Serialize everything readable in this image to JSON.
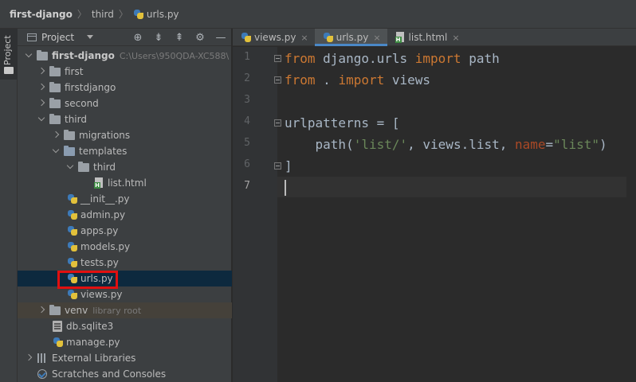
{
  "breadcrumb": {
    "project": "first-django",
    "folder": "third",
    "file": "urls.py"
  },
  "toolstrip": {
    "project_label": "Project"
  },
  "panel": {
    "title": "Project",
    "tools": [
      "⊕",
      "⇟",
      "⇞",
      "⚙",
      "—"
    ]
  },
  "tree": {
    "root": {
      "name": "first-django",
      "path": "C:\\Users\\950QDA-XC588\\"
    },
    "first": "first",
    "firstdjango": "firstdjango",
    "second": "second",
    "third": "third",
    "migrations": "migrations",
    "templates": "templates",
    "templates_third": "third",
    "list_html": "list.html",
    "init_py": "__init__.py",
    "admin_py": "admin.py",
    "apps_py": "apps.py",
    "models_py": "models.py",
    "tests_py": "tests.py",
    "urls_py": "urls.py",
    "views_py": "views.py",
    "venv": "venv",
    "venv_hint": "library root",
    "db": "db.sqlite3",
    "manage": "manage.py",
    "external": "External Libraries",
    "scratches": "Scratches and Consoles"
  },
  "tabs": [
    {
      "label": "views.py",
      "close": "×"
    },
    {
      "label": "urls.py",
      "close": "×"
    },
    {
      "label": "list.html",
      "close": "×"
    }
  ],
  "editor": {
    "line_numbers": [
      "1",
      "2",
      "3",
      "4",
      "5",
      "6",
      "7"
    ],
    "line1": {
      "kw1": "from",
      "mod": " django.urls ",
      "kw2": "import",
      "rest": " path"
    },
    "line2": {
      "kw1": "from",
      "mod": " . ",
      "kw2": "import",
      "rest": " views"
    },
    "line4": "urlpatterns = [",
    "line5": {
      "indent": "    path(",
      "str1": "'list/'",
      "mid": ", views.list, ",
      "param": "name",
      "eq": "=",
      "str2": "\"list\"",
      "end": ")"
    },
    "line6": "]"
  },
  "colors": {
    "keyword": "#cc7832",
    "string": "#6a8759",
    "param": "#aa4926",
    "highlight_box": "#e01010",
    "selection": "#0d293e"
  }
}
